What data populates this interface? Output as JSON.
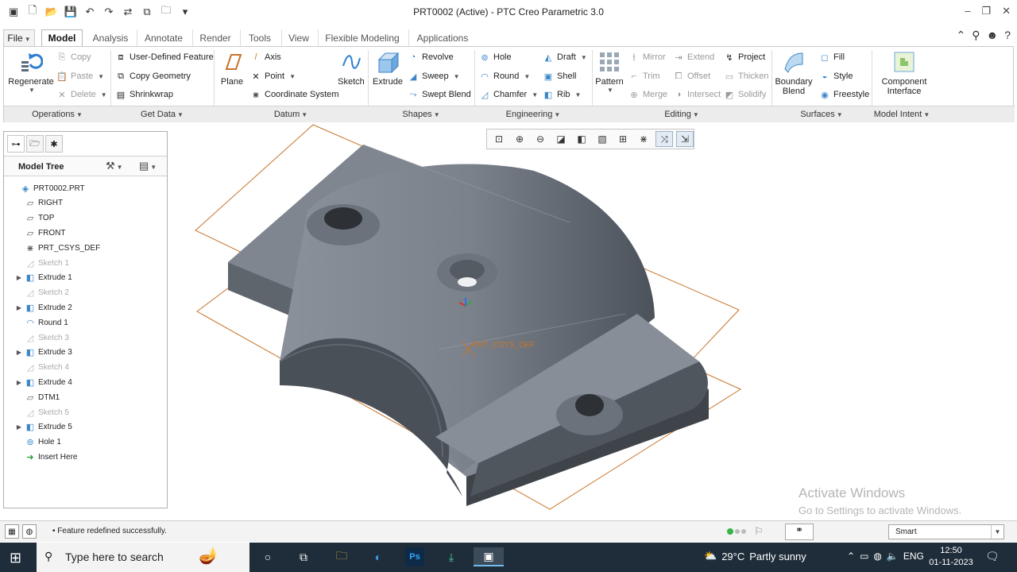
{
  "window": {
    "title": "PRT0002 (Active) - PTC Creo Parametric 3.0"
  },
  "tabs": [
    {
      "label": "File",
      "dropdown": true
    },
    {
      "label": "Model"
    },
    {
      "label": "Analysis"
    },
    {
      "label": "Annotate"
    },
    {
      "label": "Render"
    },
    {
      "label": "Tools"
    },
    {
      "label": "View"
    },
    {
      "label": "Flexible Modeling"
    },
    {
      "label": "Applications"
    }
  ],
  "ribbon": {
    "operations": {
      "regenerate": "Regenerate",
      "copy": "Copy",
      "paste": "Paste",
      "delete": "Delete"
    },
    "getdata": {
      "udf": "User-Defined Feature",
      "copygeom": "Copy Geometry",
      "shrinkwrap": "Shrinkwrap"
    },
    "datum": {
      "plane": "Plane",
      "axis": "Axis",
      "point": "Point",
      "csys": "Coordinate System",
      "sketch": "Sketch"
    },
    "shapes": {
      "extrude": "Extrude",
      "revolve": "Revolve",
      "sweep": "Sweep",
      "sweptblend": "Swept Blend"
    },
    "engineering": {
      "hole": "Hole",
      "round": "Round",
      "chamfer": "Chamfer",
      "draft": "Draft",
      "shell": "Shell",
      "rib": "Rib"
    },
    "editing": {
      "pattern": "Pattern",
      "mirror": "Mirror",
      "trim": "Trim",
      "merge": "Merge",
      "extend": "Extend",
      "offset": "Offset",
      "intersect": "Intersect",
      "project": "Project",
      "thicken": "Thicken",
      "solidify": "Solidify"
    },
    "surfaces": {
      "boundary": "Boundary",
      "blend": "Blend",
      "fill": "Fill",
      "style": "Style",
      "freestyle": "Freestyle"
    },
    "intent": {
      "component": "Component",
      "interface": "Interface"
    },
    "groups": {
      "operations": "Operations",
      "getdata": "Get Data",
      "datum": "Datum",
      "shapes": "Shapes",
      "engineering": "Engineering",
      "editing": "Editing",
      "surfaces": "Surfaces",
      "intent": "Model Intent"
    }
  },
  "modeltree": {
    "title": "Model Tree",
    "nodes": [
      {
        "label": "PRT0002.PRT",
        "icon": "part-icon",
        "dim": false,
        "expand": false
      },
      {
        "label": "RIGHT",
        "icon": "datum-plane-icon",
        "dim": false,
        "expand": false
      },
      {
        "label": "TOP",
        "icon": "datum-plane-icon",
        "dim": false,
        "expand": false
      },
      {
        "label": "FRONT",
        "icon": "datum-plane-icon",
        "dim": false,
        "expand": false
      },
      {
        "label": "PRT_CSYS_DEF",
        "icon": "csys-icon",
        "dim": false,
        "expand": false
      },
      {
        "label": "Sketch 1",
        "icon": "sketch-icon",
        "dim": true,
        "expand": false
      },
      {
        "label": "Extrude 1",
        "icon": "extrude-icon",
        "dim": false,
        "expand": true
      },
      {
        "label": "Sketch 2",
        "icon": "sketch-icon",
        "dim": true,
        "expand": false
      },
      {
        "label": "Extrude 2",
        "icon": "extrude-icon",
        "dim": false,
        "expand": true
      },
      {
        "label": "Round 1",
        "icon": "round-icon",
        "dim": false,
        "expand": false
      },
      {
        "label": "Sketch 3",
        "icon": "sketch-icon",
        "dim": true,
        "expand": false
      },
      {
        "label": "Extrude 3",
        "icon": "extrude-icon",
        "dim": false,
        "expand": true
      },
      {
        "label": "Sketch 4",
        "icon": "sketch-icon",
        "dim": true,
        "expand": false
      },
      {
        "label": "Extrude 4",
        "icon": "extrude-icon",
        "dim": false,
        "expand": true
      },
      {
        "label": "DTM1",
        "icon": "datum-plane-icon",
        "dim": false,
        "expand": false
      },
      {
        "label": "Sketch 5",
        "icon": "sketch-icon",
        "dim": true,
        "expand": false
      },
      {
        "label": "Extrude 5",
        "icon": "extrude-icon",
        "dim": false,
        "expand": true
      },
      {
        "label": "Hole 1",
        "icon": "hole-icon",
        "dim": false,
        "expand": false
      },
      {
        "label": "Insert Here",
        "icon": "insert-arrow-icon",
        "dim": false,
        "expand": false
      }
    ]
  },
  "viewport": {
    "csys_label": "PRT_CSYS_DEF"
  },
  "watermark": {
    "line1": "Activate Windows",
    "line2": "Go to Settings to activate Windows."
  },
  "status": {
    "message": "Feature redefined successfully.",
    "filter": "Smart"
  },
  "taskbar": {
    "search_placeholder": "Type here to search",
    "temperature": "29°C",
    "weather": "Partly sunny",
    "language": "ENG",
    "time": "12:50",
    "date": "01-11-2023"
  },
  "colors": {
    "part_face": "#7b828c",
    "datum_plane": "#c8742a",
    "taskbar": "#1f2d3a"
  }
}
